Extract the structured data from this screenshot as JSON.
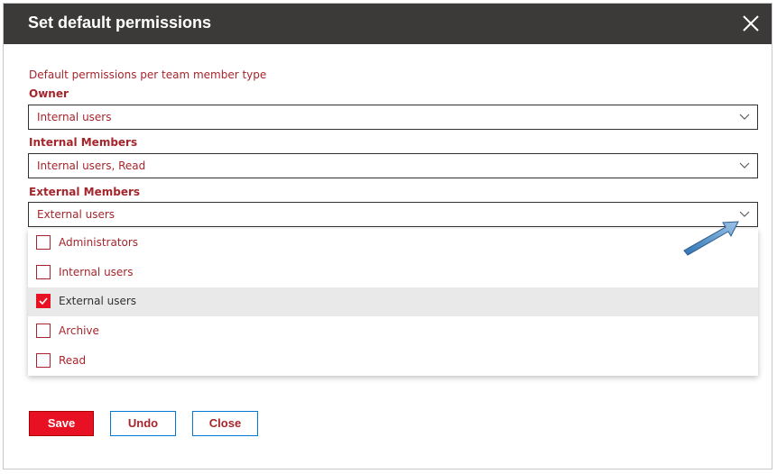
{
  "dialog": {
    "title": "Set default permissions",
    "subtitle": "Default permissions per team member type"
  },
  "fields": {
    "owner": {
      "label": "Owner",
      "value": "Internal users"
    },
    "internal_members": {
      "label": "Internal Members",
      "value": "Internal users, Read"
    },
    "external_members": {
      "label": "External Members",
      "value": "External users"
    }
  },
  "dropdown": {
    "options": [
      {
        "label": "Administrators",
        "checked": false
      },
      {
        "label": "Internal users",
        "checked": false
      },
      {
        "label": "External users",
        "checked": true
      },
      {
        "label": "Archive",
        "checked": false
      },
      {
        "label": "Read",
        "checked": false
      }
    ]
  },
  "buttons": {
    "save": "Save",
    "undo": "Undo",
    "close": "Close"
  },
  "colors": {
    "header_bg": "#3b3a39",
    "accent_text": "#a4262c",
    "primary_button": "#e81123",
    "secondary_border": "#0078d4",
    "annotation_arrow": "#5b9bd5"
  },
  "icons": {
    "close": "close-icon",
    "chevron": "chevron-down-icon",
    "check": "checkmark-icon",
    "annotation": "arrow-annotation"
  }
}
